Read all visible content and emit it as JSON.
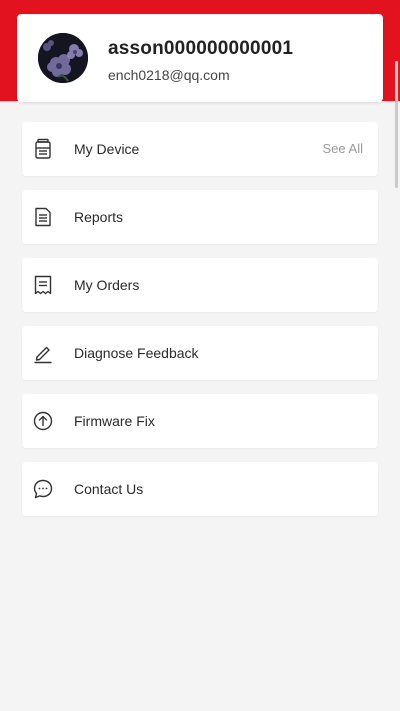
{
  "profile": {
    "username": "asson000000000001",
    "email": "ench0218@qq.com"
  },
  "colors": {
    "brand_red": "#e2131e",
    "background": "#f4f4f4",
    "card": "#ffffff"
  },
  "menu": {
    "items": [
      {
        "label": "My Device",
        "icon": "device-icon",
        "action_label": "See All"
      },
      {
        "label": "Reports",
        "icon": "document-icon"
      },
      {
        "label": "My Orders",
        "icon": "receipt-icon"
      },
      {
        "label": "Diagnose Feedback",
        "icon": "pencil-icon"
      },
      {
        "label": "Firmware Fix",
        "icon": "upload-arrow-icon"
      },
      {
        "label": "Contact Us",
        "icon": "chat-bubble-icon"
      }
    ]
  }
}
